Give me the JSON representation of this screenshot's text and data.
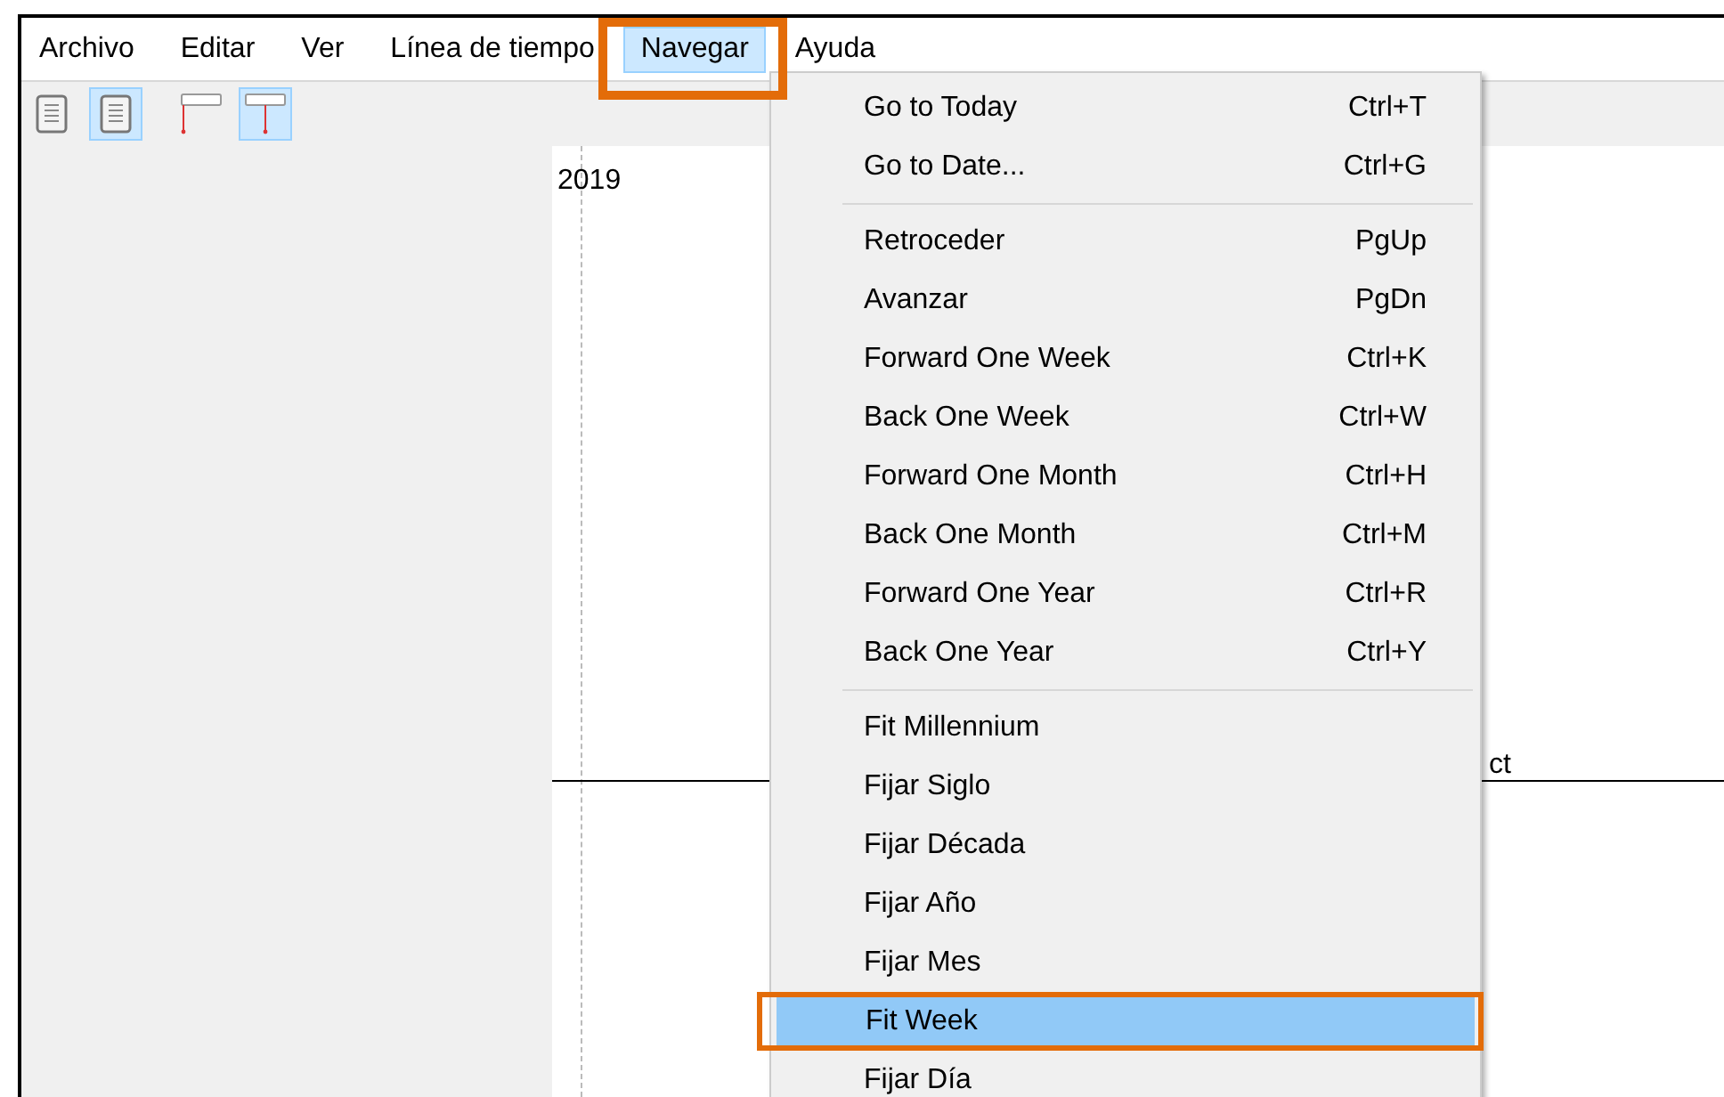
{
  "menu_bar": [
    {
      "label": "Archivo",
      "selected": false
    },
    {
      "label": "Editar",
      "selected": false
    },
    {
      "label": "Ver",
      "selected": false
    },
    {
      "label": "Línea de tiempo",
      "selected": false
    },
    {
      "label": "Navegar",
      "selected": true
    },
    {
      "label": "Ayuda",
      "selected": false
    }
  ],
  "toolbar": [
    {
      "kind": "list",
      "selected": false
    },
    {
      "kind": "list",
      "selected": true
    },
    {
      "kind": "flag",
      "selected": false
    },
    {
      "kind": "pin",
      "selected": true
    }
  ],
  "timeline": {
    "year_label": "2019",
    "event_label": "ct"
  },
  "menu": {
    "groups": [
      [
        {
          "label": "Go to Today",
          "shortcut": "Ctrl+T",
          "selected": false
        },
        {
          "label": "Go to Date...",
          "shortcut": "Ctrl+G",
          "selected": false
        }
      ],
      [
        {
          "label": "Retroceder",
          "shortcut": "PgUp",
          "selected": false
        },
        {
          "label": "Avanzar",
          "shortcut": "PgDn",
          "selected": false
        },
        {
          "label": "Forward One Week",
          "shortcut": "Ctrl+K",
          "selected": false
        },
        {
          "label": "Back One Week",
          "shortcut": "Ctrl+W",
          "selected": false
        },
        {
          "label": "Forward One Month",
          "shortcut": "Ctrl+H",
          "selected": false
        },
        {
          "label": "Back One Month",
          "shortcut": "Ctrl+M",
          "selected": false
        },
        {
          "label": "Forward One Year",
          "shortcut": "Ctrl+R",
          "selected": false
        },
        {
          "label": "Back One Year",
          "shortcut": "Ctrl+Y",
          "selected": false
        }
      ],
      [
        {
          "label": "Fit Millennium",
          "selected": false
        },
        {
          "label": "Fijar Siglo",
          "selected": false
        },
        {
          "label": "Fijar Década",
          "selected": false
        },
        {
          "label": "Fijar Año",
          "selected": false
        },
        {
          "label": "Fijar Mes",
          "selected": false
        },
        {
          "label": "Fit Week",
          "selected": true
        },
        {
          "label": "Fijar Día",
          "selected": false
        }
      ]
    ]
  }
}
